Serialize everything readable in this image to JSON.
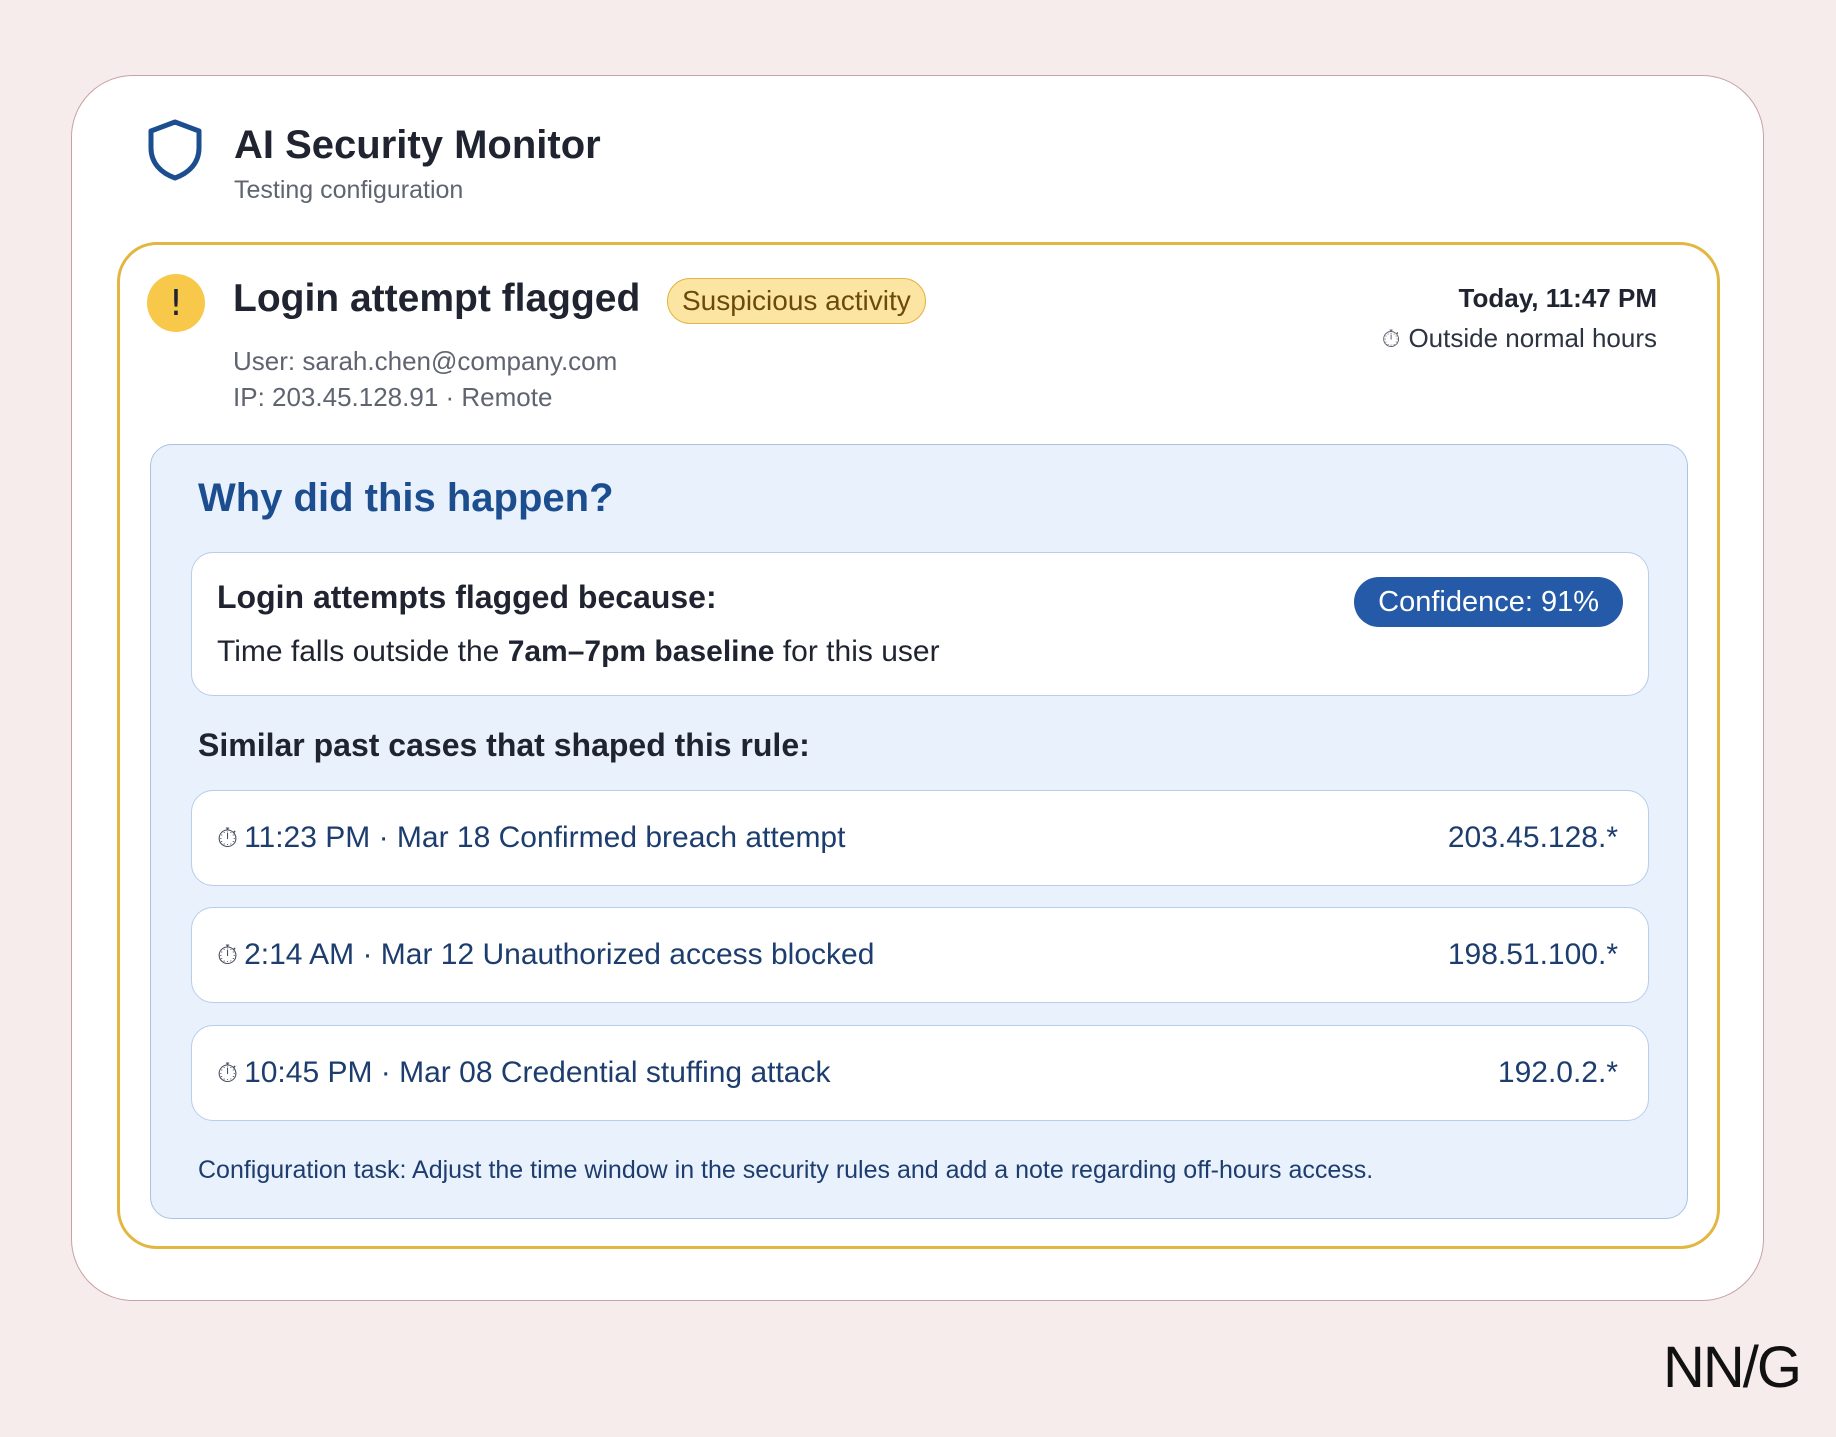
{
  "app": {
    "title": "AI Security Monitor",
    "subtitle": "Testing configuration",
    "icon": "shield-icon"
  },
  "alert": {
    "icon": "warning-icon",
    "icon_glyph": "!",
    "title": "Login attempt flagged",
    "badge": "Suspicious activity",
    "user": "User: sarah.chen@company.com",
    "ip": "IP: 203.45.128.91 · Remote",
    "time": "Today, 11:47 PM",
    "time_note": "Outside normal hours",
    "time_note_icon": "stopwatch-icon"
  },
  "explanation": {
    "title": "Why did this happen?",
    "reason_heading": "Login attempts flagged because:",
    "reason_prefix": "Time falls outside the ",
    "reason_bold": "7am–7pm baseline",
    "reason_suffix": " for this user",
    "confidence": "Confidence: 91%",
    "cases_heading": "Similar past cases that shaped this rule:",
    "cases": [
      {
        "time": "11:23 PM · Mar 18",
        "description": "Confirmed breach attempt",
        "ip": "203.45.128.*"
      },
      {
        "time": "2:14 AM · Mar 12",
        "description": "Unauthorized access blocked",
        "ip": "198.51.100.*"
      },
      {
        "time": "10:45 PM · Mar 08",
        "description": "Credential stuffing attack",
        "ip": "192.0.2.*"
      }
    ],
    "task_note": "Configuration task: Adjust the time window in the security rules and add a note regarding off-hours access."
  },
  "logo": "NN/G",
  "colors": {
    "background": "#f6ecec",
    "alert_border": "#e3b541",
    "warning_fill": "#f8c84b",
    "explanation_bg": "#e9f1fd",
    "brand_blue": "#1c4d8f",
    "confidence_bg": "#245aa7"
  }
}
